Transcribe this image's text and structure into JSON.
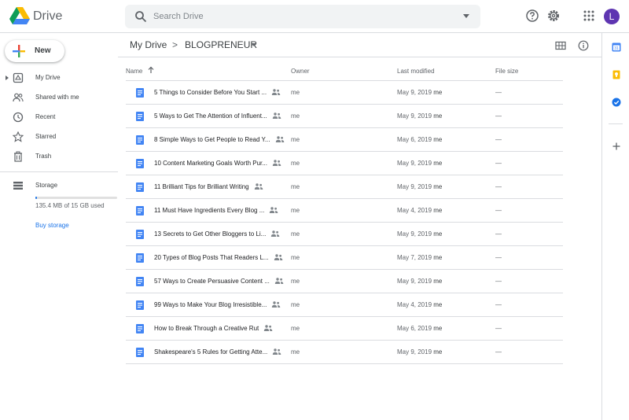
{
  "app": {
    "name": "Drive"
  },
  "search": {
    "placeholder": "Search Drive"
  },
  "user": {
    "initial": "L",
    "avatar_color": "#5e35b1"
  },
  "sidebar": {
    "new_label": "New",
    "items": [
      {
        "label": "My Drive",
        "icon": "drive-icon"
      },
      {
        "label": "Shared with me",
        "icon": "people-icon"
      },
      {
        "label": "Recent",
        "icon": "clock-icon"
      },
      {
        "label": "Starred",
        "icon": "star-icon"
      },
      {
        "label": "Trash",
        "icon": "trash-icon"
      }
    ],
    "storage_label": "Storage",
    "storage_used": "135.4 MB of 15 GB used",
    "storage_fraction": 0.009,
    "buy_storage": "Buy storage"
  },
  "breadcrumb": {
    "root": "My Drive",
    "separator": ">",
    "current": "BLOGPRENEUR"
  },
  "table": {
    "headers": {
      "name": "Name",
      "owner": "Owner",
      "modified": "Last modified",
      "size": "File size"
    },
    "rows": [
      {
        "name": "5 Things to Consider Before You Start ...",
        "owner": "me",
        "date": "May 9, 2019",
        "by": "me",
        "size": "—"
      },
      {
        "name": "5 Ways to Get The Attention of Influent...",
        "owner": "me",
        "date": "May 9, 2019",
        "by": "me",
        "size": "—"
      },
      {
        "name": "8 Simple Ways to Get People to Read Y...",
        "owner": "me",
        "date": "May 6, 2019",
        "by": "me",
        "size": "—"
      },
      {
        "name": "10 Content Marketing Goals Worth Pur...",
        "owner": "me",
        "date": "May 9, 2019",
        "by": "me",
        "size": "—"
      },
      {
        "name": "11 Brilliant Tips for Brilliant Writing",
        "owner": "me",
        "date": "May 9, 2019",
        "by": "me",
        "size": "—"
      },
      {
        "name": "11 Must Have Ingredients Every Blog ...",
        "owner": "me",
        "date": "May 4, 2019",
        "by": "me",
        "size": "—"
      },
      {
        "name": "13 Secrets to Get Other Bloggers to Li...",
        "owner": "me",
        "date": "May 9, 2019",
        "by": "me",
        "size": "—"
      },
      {
        "name": "20 Types of Blog Posts That Readers L...",
        "owner": "me",
        "date": "May 7, 2019",
        "by": "me",
        "size": "—"
      },
      {
        "name": "57 Ways to Create Persuasive Content ...",
        "owner": "me",
        "date": "May 9, 2019",
        "by": "me",
        "size": "—"
      },
      {
        "name": "99 Ways to Make Your Blog Irresistible...",
        "owner": "me",
        "date": "May 4, 2019",
        "by": "me",
        "size": "—"
      },
      {
        "name": "How to Break Through a Creative Rut",
        "owner": "me",
        "date": "May 6, 2019",
        "by": "me",
        "size": "—"
      },
      {
        "name": "Shakespeare's 5 Rules for Getting Atte...",
        "owner": "me",
        "date": "May 9, 2019",
        "by": "me",
        "size": "—"
      }
    ]
  },
  "colors": {
    "accent": "#1a73e8",
    "doc_blue": "#4285f4",
    "divider": "#dadce0"
  }
}
